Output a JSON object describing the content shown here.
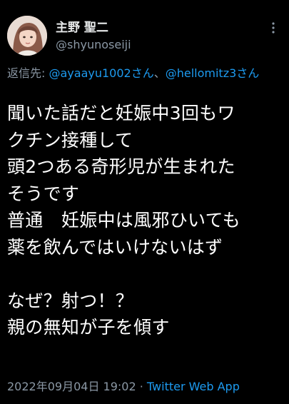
{
  "tweet": {
    "author": {
      "display_name": "主野 聖二",
      "handle": "@shyunoseiji"
    },
    "reply_to": {
      "prefix": "返信先:",
      "mention_1": "@ayaayu1002さん",
      "separator": "、",
      "mention_2": "@hellomitz3さん"
    },
    "body_lines": [
      "聞いた話だと妊娠中3回もワ",
      "クチン接種して",
      "頭2つある奇形児が生まれた",
      "そうです",
      "普通　妊娠中は風邪ひいても",
      "薬を飲んではいけないはず",
      "",
      "なぜ？射つ！？",
      "親の無知が子を傾す"
    ],
    "timestamp": "2022年09月04日 19:02",
    "meta_separator": " · ",
    "source_app": "Twitter Web App"
  },
  "icons": {
    "more": "more-vertical-icon",
    "avatar": "avatar-image"
  },
  "colors": {
    "background": "#000000",
    "text": "#ffffff",
    "secondary": "#8b98a5",
    "link": "#1d9bf0"
  }
}
